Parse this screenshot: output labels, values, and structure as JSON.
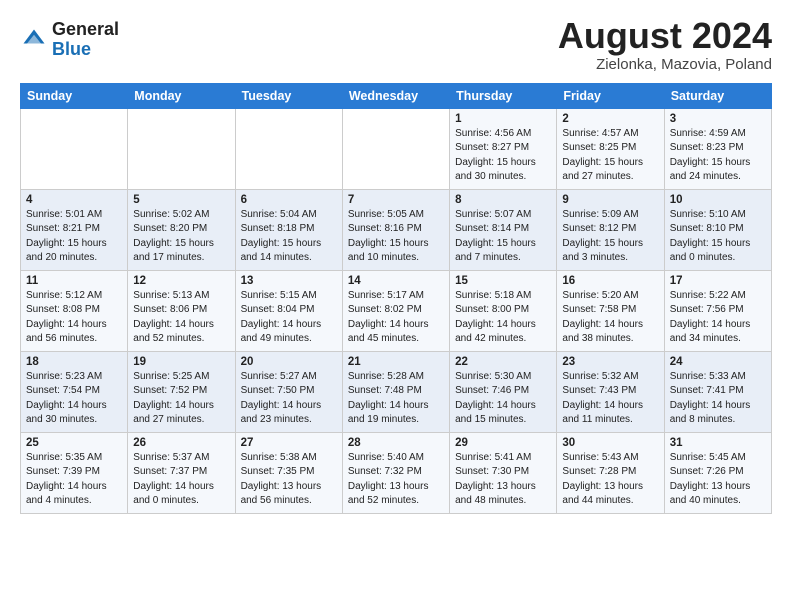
{
  "header": {
    "logo_line1": "General",
    "logo_line2": "Blue",
    "title": "August 2024",
    "subtitle": "Zielonka, Mazovia, Poland"
  },
  "weekdays": [
    "Sunday",
    "Monday",
    "Tuesday",
    "Wednesday",
    "Thursday",
    "Friday",
    "Saturday"
  ],
  "rows": [
    [
      {
        "day": "",
        "info": ""
      },
      {
        "day": "",
        "info": ""
      },
      {
        "day": "",
        "info": ""
      },
      {
        "day": "",
        "info": ""
      },
      {
        "day": "1",
        "info": "Sunrise: 4:56 AM\nSunset: 8:27 PM\nDaylight: 15 hours\nand 30 minutes."
      },
      {
        "day": "2",
        "info": "Sunrise: 4:57 AM\nSunset: 8:25 PM\nDaylight: 15 hours\nand 27 minutes."
      },
      {
        "day": "3",
        "info": "Sunrise: 4:59 AM\nSunset: 8:23 PM\nDaylight: 15 hours\nand 24 minutes."
      }
    ],
    [
      {
        "day": "4",
        "info": "Sunrise: 5:01 AM\nSunset: 8:21 PM\nDaylight: 15 hours\nand 20 minutes."
      },
      {
        "day": "5",
        "info": "Sunrise: 5:02 AM\nSunset: 8:20 PM\nDaylight: 15 hours\nand 17 minutes."
      },
      {
        "day": "6",
        "info": "Sunrise: 5:04 AM\nSunset: 8:18 PM\nDaylight: 15 hours\nand 14 minutes."
      },
      {
        "day": "7",
        "info": "Sunrise: 5:05 AM\nSunset: 8:16 PM\nDaylight: 15 hours\nand 10 minutes."
      },
      {
        "day": "8",
        "info": "Sunrise: 5:07 AM\nSunset: 8:14 PM\nDaylight: 15 hours\nand 7 minutes."
      },
      {
        "day": "9",
        "info": "Sunrise: 5:09 AM\nSunset: 8:12 PM\nDaylight: 15 hours\nand 3 minutes."
      },
      {
        "day": "10",
        "info": "Sunrise: 5:10 AM\nSunset: 8:10 PM\nDaylight: 15 hours\nand 0 minutes."
      }
    ],
    [
      {
        "day": "11",
        "info": "Sunrise: 5:12 AM\nSunset: 8:08 PM\nDaylight: 14 hours\nand 56 minutes."
      },
      {
        "day": "12",
        "info": "Sunrise: 5:13 AM\nSunset: 8:06 PM\nDaylight: 14 hours\nand 52 minutes."
      },
      {
        "day": "13",
        "info": "Sunrise: 5:15 AM\nSunset: 8:04 PM\nDaylight: 14 hours\nand 49 minutes."
      },
      {
        "day": "14",
        "info": "Sunrise: 5:17 AM\nSunset: 8:02 PM\nDaylight: 14 hours\nand 45 minutes."
      },
      {
        "day": "15",
        "info": "Sunrise: 5:18 AM\nSunset: 8:00 PM\nDaylight: 14 hours\nand 42 minutes."
      },
      {
        "day": "16",
        "info": "Sunrise: 5:20 AM\nSunset: 7:58 PM\nDaylight: 14 hours\nand 38 minutes."
      },
      {
        "day": "17",
        "info": "Sunrise: 5:22 AM\nSunset: 7:56 PM\nDaylight: 14 hours\nand 34 minutes."
      }
    ],
    [
      {
        "day": "18",
        "info": "Sunrise: 5:23 AM\nSunset: 7:54 PM\nDaylight: 14 hours\nand 30 minutes."
      },
      {
        "day": "19",
        "info": "Sunrise: 5:25 AM\nSunset: 7:52 PM\nDaylight: 14 hours\nand 27 minutes."
      },
      {
        "day": "20",
        "info": "Sunrise: 5:27 AM\nSunset: 7:50 PM\nDaylight: 14 hours\nand 23 minutes."
      },
      {
        "day": "21",
        "info": "Sunrise: 5:28 AM\nSunset: 7:48 PM\nDaylight: 14 hours\nand 19 minutes."
      },
      {
        "day": "22",
        "info": "Sunrise: 5:30 AM\nSunset: 7:46 PM\nDaylight: 14 hours\nand 15 minutes."
      },
      {
        "day": "23",
        "info": "Sunrise: 5:32 AM\nSunset: 7:43 PM\nDaylight: 14 hours\nand 11 minutes."
      },
      {
        "day": "24",
        "info": "Sunrise: 5:33 AM\nSunset: 7:41 PM\nDaylight: 14 hours\nand 8 minutes."
      }
    ],
    [
      {
        "day": "25",
        "info": "Sunrise: 5:35 AM\nSunset: 7:39 PM\nDaylight: 14 hours\nand 4 minutes."
      },
      {
        "day": "26",
        "info": "Sunrise: 5:37 AM\nSunset: 7:37 PM\nDaylight: 14 hours\nand 0 minutes."
      },
      {
        "day": "27",
        "info": "Sunrise: 5:38 AM\nSunset: 7:35 PM\nDaylight: 13 hours\nand 56 minutes."
      },
      {
        "day": "28",
        "info": "Sunrise: 5:40 AM\nSunset: 7:32 PM\nDaylight: 13 hours\nand 52 minutes."
      },
      {
        "day": "29",
        "info": "Sunrise: 5:41 AM\nSunset: 7:30 PM\nDaylight: 13 hours\nand 48 minutes."
      },
      {
        "day": "30",
        "info": "Sunrise: 5:43 AM\nSunset: 7:28 PM\nDaylight: 13 hours\nand 44 minutes."
      },
      {
        "day": "31",
        "info": "Sunrise: 5:45 AM\nSunset: 7:26 PM\nDaylight: 13 hours\nand 40 minutes."
      }
    ]
  ]
}
